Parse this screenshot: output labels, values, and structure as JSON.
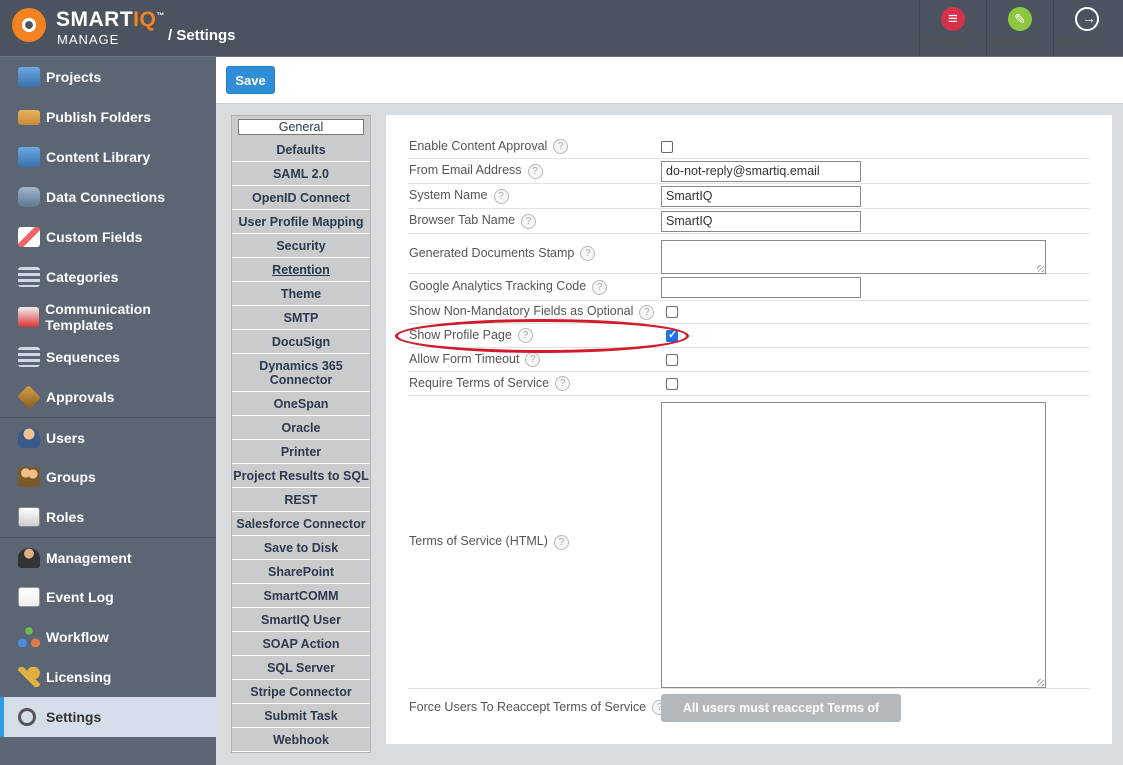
{
  "header": {
    "brand_smart": "SMART",
    "brand_iq": "IQ",
    "brand_tm": "™",
    "brand_sub": "MANAGE",
    "breadcrumb": "/ Settings",
    "buttons": [
      {
        "label": "Produce",
        "icon": "produce-icon"
      },
      {
        "label": "Design",
        "icon": "design-icon"
      },
      {
        "label": "Log Out",
        "icon": "logout-icon"
      }
    ]
  },
  "sidebar": {
    "items": [
      {
        "label": "Projects",
        "icon": "projects-icon"
      },
      {
        "label": "Publish Folders",
        "icon": "folder-icon"
      },
      {
        "label": "Content Library",
        "icon": "library-icon"
      },
      {
        "label": "Data Connections",
        "icon": "database-icon"
      },
      {
        "label": "Custom Fields",
        "icon": "pen-icon"
      },
      {
        "label": "Categories",
        "icon": "list-icon"
      },
      {
        "label": "Communication Templates",
        "icon": "megaphone-icon"
      },
      {
        "label": "Sequences",
        "icon": "sequence-icon"
      },
      {
        "label": "Approvals",
        "icon": "approval-icon"
      },
      {
        "label": "Users",
        "icon": "user-icon"
      },
      {
        "label": "Groups",
        "icon": "group-icon"
      },
      {
        "label": "Roles",
        "icon": "role-icon"
      },
      {
        "label": "Management",
        "icon": "manager-icon"
      },
      {
        "label": "Event Log",
        "icon": "event-log-icon"
      },
      {
        "label": "Workflow",
        "icon": "workflow-icon"
      },
      {
        "label": "Licensing",
        "icon": "key-icon"
      },
      {
        "label": "Settings",
        "icon": "gear-icon"
      }
    ]
  },
  "toolbar": {
    "save_label": "Save"
  },
  "tabs": [
    "General",
    "Defaults",
    "SAML 2.0",
    "OpenID Connect",
    "User Profile Mapping",
    "Security",
    "Retention",
    "Theme",
    "SMTP",
    "DocuSign",
    "Dynamics 365 Connector",
    "OneSpan",
    "Oracle",
    "Printer",
    "Project Results to SQL",
    "REST",
    "Salesforce Connector",
    "Save to Disk",
    "SharePoint",
    "SmartCOMM",
    "SmartIQ User",
    "SOAP Action",
    "SQL Server",
    "Stripe Connector",
    "Submit Task",
    "Webhook"
  ],
  "form": {
    "help_glyph": "?",
    "enable_content_approval": {
      "label": "Enable Content Approval",
      "checked": false
    },
    "from_email": {
      "label": "From Email Address",
      "value": "do-not-reply@smartiq.email"
    },
    "system_name": {
      "label": "System Name",
      "value": "SmartIQ"
    },
    "browser_tab_name": {
      "label": "Browser Tab Name",
      "value": "SmartIQ"
    },
    "generated_stamp": {
      "label": "Generated Documents Stamp",
      "value": ""
    },
    "ga_code": {
      "label": "Google Analytics Tracking Code",
      "value": ""
    },
    "show_non_mandatory": {
      "label": "Show Non-Mandatory Fields as Optional",
      "checked": false
    },
    "show_profile_page": {
      "label": "Show Profile Page",
      "checked": true
    },
    "allow_form_timeout": {
      "label": "Allow Form Timeout",
      "checked": false
    },
    "require_tos": {
      "label": "Require Terms of Service",
      "checked": false
    },
    "tos_html": {
      "label": "Terms of Service (HTML)",
      "value": ""
    },
    "force_reaccept": {
      "label": "Force Users To Reaccept Terms of Service",
      "button_label": "All users must reaccept Terms of Service"
    }
  },
  "colors": {
    "accent": "#2f8ed8",
    "logo_orange": "#f58220",
    "annotation_red": "#d01b2a"
  }
}
